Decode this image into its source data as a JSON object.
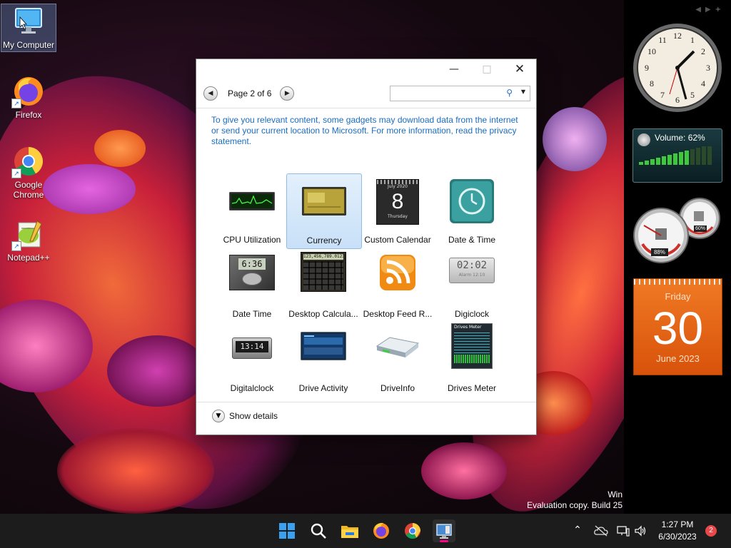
{
  "desktop": {
    "icons": [
      {
        "label": "My Computer",
        "icon": "computer-icon"
      },
      {
        "label": "Firefox",
        "icon": "firefox-icon"
      },
      {
        "label": "Google Chrome",
        "icon": "chrome-icon"
      },
      {
        "label": "Notepad++",
        "icon": "notepadpp-icon"
      }
    ],
    "watermark": {
      "line1": "Win",
      "line2": "Evaluation copy. Build 25"
    }
  },
  "gadget_window": {
    "page_label": "Page 2 of 6",
    "search": {
      "value": "",
      "placeholder": ""
    },
    "info_text": "To give you relevant content, some gadgets may download data from the internet or send your current location to Microsoft. For more information, read the privacy statement.",
    "gadgets": [
      {
        "label": "CPU Utilization",
        "selected": false
      },
      {
        "label": "Currency",
        "selected": true
      },
      {
        "label": "Custom Calendar",
        "selected": false
      },
      {
        "label": "Date & Time",
        "selected": false
      },
      {
        "label": "Date Time",
        "selected": false
      },
      {
        "label": "Desktop Calcula...",
        "selected": false
      },
      {
        "label": "Desktop Feed R...",
        "selected": false
      },
      {
        "label": "Digiclock",
        "selected": false
      },
      {
        "label": "Digitalclock",
        "selected": false
      },
      {
        "label": "Drive Activity",
        "selected": false
      },
      {
        "label": "DriveInfo",
        "selected": false
      },
      {
        "label": "Drives Meter",
        "selected": false
      }
    ],
    "thumb_text": {
      "calendar_month": "July 2020",
      "calendar_day": "8",
      "calendar_weekday": "Thursday",
      "datetime_display": "6:36",
      "calc_display": "123,456,789.0123",
      "digiclock_time": "02:02",
      "digiclock_sub": "Alarm 12:10",
      "digitalclock_time": "13:14",
      "drives_meter_title": "Drives Meter"
    },
    "show_details_label": "Show details"
  },
  "sidebar_gadgets": {
    "volume_label": "Volume: 62%",
    "meter_cpu": "88%",
    "meter_ram": "60%",
    "calendar": {
      "weekday": "Friday",
      "day": "30",
      "month_year": "June 2023"
    }
  },
  "taskbar": {
    "apps": [
      "start-icon",
      "search-icon",
      "file-explorer-icon",
      "firefox-icon",
      "chrome-icon",
      "gadgets-icon"
    ],
    "time": "1:27 PM",
    "date": "6/30/2023",
    "notification_count": "2"
  },
  "colors": {
    "accent": "#1a6cc1",
    "calendar_orange": "#e8620e",
    "selection": "#c8e0f8"
  }
}
